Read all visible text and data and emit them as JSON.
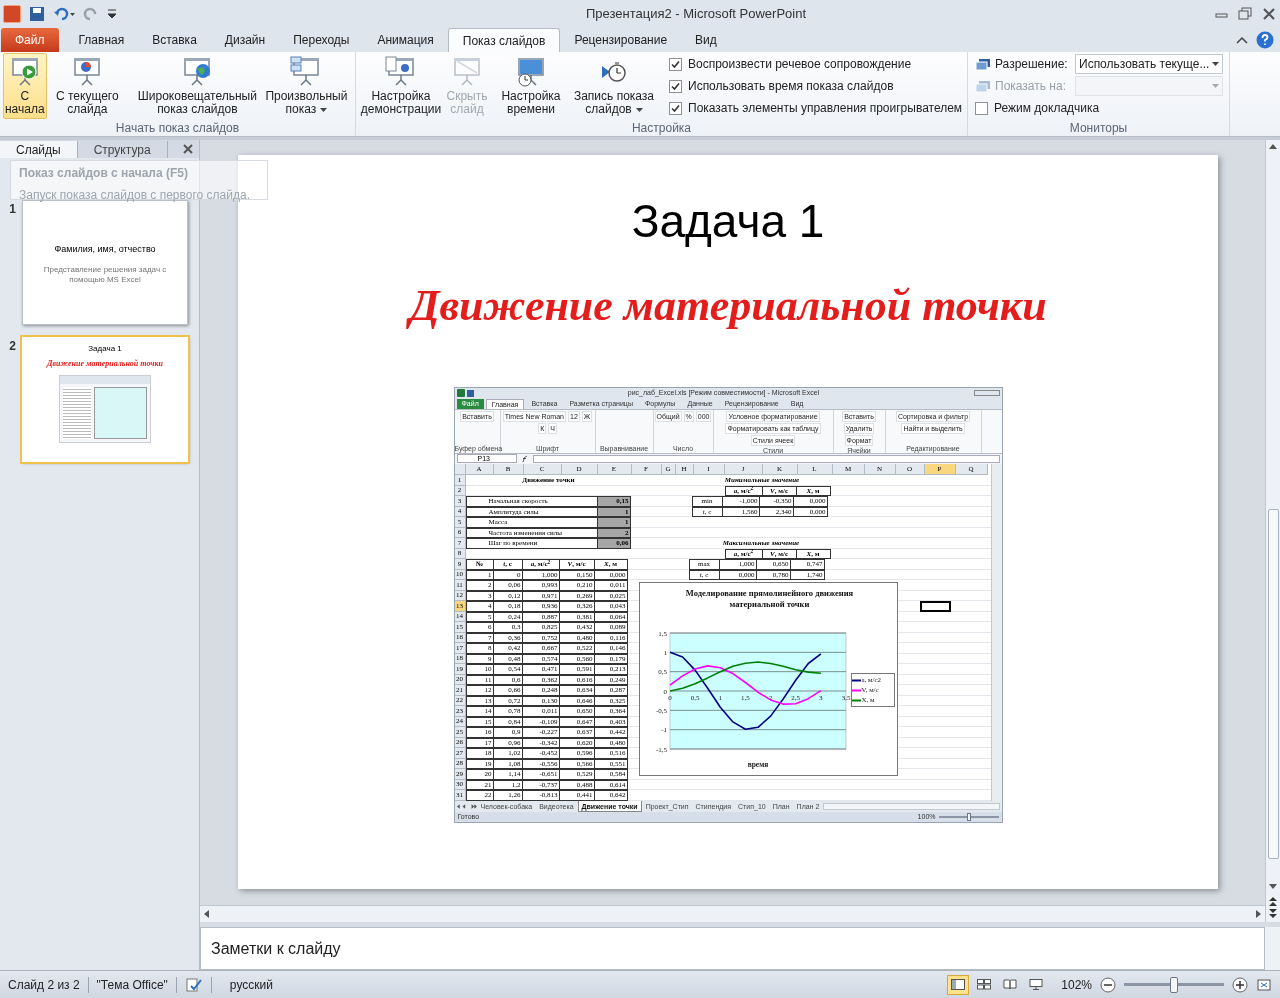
{
  "window": {
    "title": "Презентация2  -  Microsoft PowerPoint"
  },
  "ribbon_tabs": [
    {
      "label": "Файл",
      "kind": "file",
      "selected": false
    },
    {
      "label": "Главная",
      "kind": "tab",
      "selected": false
    },
    {
      "label": "Вставка",
      "kind": "tab",
      "selected": false
    },
    {
      "label": "Дизайн",
      "kind": "tab",
      "selected": false
    },
    {
      "label": "Переходы",
      "kind": "tab",
      "selected": false
    },
    {
      "label": "Анимация",
      "kind": "tab",
      "selected": false
    },
    {
      "label": "Показ слайдов",
      "kind": "tab",
      "selected": true
    },
    {
      "label": "Рецензирование",
      "kind": "tab",
      "selected": false
    },
    {
      "label": "Вид",
      "kind": "tab",
      "selected": false
    }
  ],
  "ribbon_groups": [
    {
      "label": "Начать показ слайдов",
      "buttons": [
        {
          "label": "С начала",
          "kind": "play",
          "hover": true,
          "disabled": false,
          "dropdown": false
        },
        {
          "label": "С текущего слайда",
          "kind": "current",
          "hover": false,
          "disabled": false,
          "dropdown": false
        },
        {
          "label": "Широковещательный показ слайдов",
          "kind": "broadcast",
          "hover": false,
          "disabled": false,
          "dropdown": false
        },
        {
          "label": "Произвольный показ",
          "kind": "custom",
          "hover": false,
          "disabled": false,
          "dropdown": true
        }
      ]
    },
    {
      "label": "Настройка",
      "buttons": [
        {
          "label": "Настройка демонстрации",
          "kind": "setup",
          "hover": false,
          "disabled": false,
          "dropdown": false
        },
        {
          "label": "Скрыть слайд",
          "kind": "hide",
          "hover": false,
          "disabled": true,
          "dropdown": false
        },
        {
          "label": "Настройка времени",
          "kind": "timing",
          "hover": false,
          "disabled": false,
          "dropdown": false
        },
        {
          "label": "Запись показа слайдов",
          "kind": "record",
          "hover": false,
          "disabled": false,
          "dropdown": true
        }
      ],
      "checkboxes": [
        {
          "label": "Воспроизвести речевое сопровождение",
          "checked": true
        },
        {
          "label": "Использовать время показа слайдов",
          "checked": true
        },
        {
          "label": "Показать элементы управления проигрывателем",
          "checked": true
        }
      ]
    },
    {
      "label": "Мониторы",
      "fields": [
        {
          "label": "Разрешение:",
          "value": "Использовать текуще...",
          "disabled": false
        },
        {
          "label": "Показать на:",
          "disabled": true
        }
      ],
      "checkboxes": [
        {
          "label": "Режим докладчика",
          "checked": false
        }
      ]
    }
  ],
  "tooltip": {
    "title": "Показ слайдов с начала (F5)",
    "text": "Запуск показа слайдов с первого слайда."
  },
  "pane": {
    "tabs": [
      {
        "label": "Слайды",
        "selected": true
      },
      {
        "label": "Структура",
        "selected": false
      }
    ],
    "thumbnails": [
      {
        "number": "1",
        "kind": "title-slide",
        "selected": false,
        "title": "Фамилия, имя, отчество",
        "subtitle": "Представление решения задач с помощью MS Excel"
      },
      {
        "number": "2",
        "kind": "content-slide",
        "selected": true,
        "title": "Задача 1",
        "subtitle": "Движение материальной точки"
      }
    ]
  },
  "slide": {
    "title": "Задача 1",
    "subtitle": "Движение материальной точки",
    "excel": {
      "title": "рис_лаб_Excel.xls  [Режим совместимости]  -  Microsoft Excel",
      "tabs": [
        {
          "label": "Файл",
          "kind": "file",
          "selected": false
        },
        {
          "label": "Главная",
          "kind": "tab",
          "selected": true
        },
        {
          "label": "Вставка",
          "kind": "tab",
          "selected": false
        },
        {
          "label": "Разметка страницы",
          "kind": "tab",
          "selected": false
        },
        {
          "label": "Формулы",
          "kind": "tab",
          "selected": false
        },
        {
          "label": "Данные",
          "kind": "tab",
          "selected": false
        },
        {
          "label": "Рецензирование",
          "kind": "tab",
          "selected": false
        },
        {
          "label": "Вид",
          "kind": "tab",
          "selected": false
        }
      ],
      "ribbon_groups": [
        {
          "label": "Буфер обмена",
          "items": [
            "Вставить"
          ]
        },
        {
          "label": "Шрифт",
          "items": [
            "Times New Roman",
            "12",
            "Ж",
            "К",
            "Ч"
          ]
        },
        {
          "label": "Выравнивание"
        },
        {
          "label": "Число",
          "items": [
            "Общий",
            "%",
            "000"
          ]
        },
        {
          "label": "Стили",
          "items": [
            "Условное форматирование",
            "Форматировать как таблицу",
            "Стили ячеек"
          ]
        },
        {
          "label": "Ячейки",
          "items": [
            "Вставить",
            "Удалить",
            "Формат"
          ]
        },
        {
          "label": "Редактирование",
          "items": [
            "Сортировка и фильтр",
            "Найти и выделить"
          ]
        }
      ],
      "name_box": "P13",
      "columns": [
        {
          "label": "A",
          "selected": false
        },
        {
          "label": "B",
          "selected": false
        },
        {
          "label": "C",
          "selected": false
        },
        {
          "label": "D",
          "selected": false
        },
        {
          "label": "E",
          "selected": false
        },
        {
          "label": "F",
          "selected": false
        },
        {
          "label": "G",
          "selected": false
        },
        {
          "label": "H",
          "selected": false
        },
        {
          "label": "I",
          "selected": false
        },
        {
          "label": "J",
          "selected": false
        },
        {
          "label": "K",
          "selected": false
        },
        {
          "label": "L",
          "selected": false
        },
        {
          "label": "M",
          "selected": false
        },
        {
          "label": "N",
          "selected": false
        },
        {
          "label": "O",
          "selected": false
        },
        {
          "label": "P",
          "selected": true
        },
        {
          "label": "Q",
          "selected": false
        }
      ],
      "row_headers": [
        {
          "label": "1",
          "selected": false
        },
        {
          "label": "2",
          "selected": false
        },
        {
          "label": "3",
          "selected": false
        },
        {
          "label": "4",
          "selected": false
        },
        {
          "label": "5",
          "selected": false
        },
        {
          "label": "6",
          "selected": false
        },
        {
          "label": "7",
          "selected": false
        },
        {
          "label": "8",
          "selected": false
        },
        {
          "label": "9",
          "selected": false
        },
        {
          "label": "10",
          "selected": false
        },
        {
          "label": "11",
          "selected": false
        },
        {
          "label": "12",
          "selected": false
        },
        {
          "label": "13",
          "selected": true
        },
        {
          "label": "14",
          "selected": false
        },
        {
          "label": "15",
          "selected": false
        },
        {
          "label": "16",
          "selected": false
        },
        {
          "label": "17",
          "selected": false
        },
        {
          "label": "18",
          "selected": false
        },
        {
          "label": "19",
          "selected": false
        },
        {
          "label": "20",
          "selected": false
        },
        {
          "label": "21",
          "selected": false
        },
        {
          "label": "22",
          "selected": false
        },
        {
          "label": "23",
          "selected": false
        },
        {
          "label": "24",
          "selected": false
        },
        {
          "label": "25",
          "selected": false
        },
        {
          "label": "26",
          "selected": false
        },
        {
          "label": "27",
          "selected": false
        },
        {
          "label": "28",
          "selected": false
        },
        {
          "label": "29",
          "selected": false
        },
        {
          "label": "30",
          "selected": false
        },
        {
          "label": "31",
          "selected": false
        }
      ],
      "sheet_title": "Движение точки",
      "params": [
        {
          "label": "Начальная скорость",
          "value": "0,15"
        },
        {
          "label": "Амплитуда силы",
          "value": "1"
        },
        {
          "label": "Масса",
          "value": "1"
        },
        {
          "label": "Частота изменения силы",
          "value": "2"
        },
        {
          "label": "Шаг по времени",
          "value": "0,06"
        }
      ],
      "min_table": {
        "caption": "Минимальные  значение",
        "columns": [
          "*a*, м/с$^{2}$",
          "*V*, м/с",
          "*X*, м"
        ],
        "rows": [
          {
            "label": "min",
            "values": [
              "-1,000",
              "-0,350",
              "0,000"
            ]
          },
          {
            "label": "*t*, с",
            "values": [
              "1,560",
              "2,340",
              "0,000"
            ]
          }
        ]
      },
      "max_table": {
        "caption": "Максимальные  значение",
        "columns": [
          "*a*, м/с$^{2}$",
          "*V*, м/с",
          "*X*, м"
        ],
        "rows": [
          {
            "label": "max",
            "values": [
              "1,000",
              "0,650",
              "0,747"
            ]
          },
          {
            "label": "*t*, с",
            "values": [
              "0,000",
              "0,780",
              "1,740"
            ]
          }
        ]
      },
      "data_table": {
        "columns": [
          "№",
          "*t*, с",
          "*a*, м/с$^{2}$",
          "*V*, м/с",
          "*X*, м"
        ],
        "rows": [
          [
            "1",
            "0",
            "1,000",
            "0,150",
            "0,000"
          ],
          [
            "2",
            "0,06",
            "0,993",
            "0,210",
            "0,011"
          ],
          [
            "3",
            "0,12",
            "0,971",
            "0,269",
            "0,025"
          ],
          [
            "4",
            "0,18",
            "0,936",
            "0,326",
            "0,043"
          ],
          [
            "5",
            "0,24",
            "0,887",
            "0,381",
            "0,064"
          ],
          [
            "6",
            "0,3",
            "0,825",
            "0,432",
            "0,089"
          ],
          [
            "7",
            "0,36",
            "0,752",
            "0,480",
            "0,116"
          ],
          [
            "8",
            "0,42",
            "0,667",
            "0,522",
            "0,146"
          ],
          [
            "9",
            "0,48",
            "0,574",
            "0,560",
            "0,179"
          ],
          [
            "10",
            "0,54",
            "0,471",
            "0,591",
            "0,213"
          ],
          [
            "11",
            "0,6",
            "0,362",
            "0,616",
            "0,249"
          ],
          [
            "12",
            "0,66",
            "0,248",
            "0,634",
            "0,287"
          ],
          [
            "13",
            "0,72",
            "0,130",
            "0,646",
            "0,325"
          ],
          [
            "14",
            "0,78",
            "0,011",
            "0,650",
            "0,364"
          ],
          [
            "15",
            "0,84",
            "-0,109",
            "0,647",
            "0,403"
          ],
          [
            "16",
            "0,9",
            "-0,227",
            "0,637",
            "0,442"
          ],
          [
            "17",
            "0,96",
            "-0,342",
            "0,620",
            "0,480"
          ],
          [
            "18",
            "1,02",
            "-0,452",
            "0,596",
            "0,516"
          ],
          [
            "19",
            "1,08",
            "-0,556",
            "0,566",
            "0,551"
          ],
          [
            "20",
            "1,14",
            "-0,651",
            "0,529",
            "0,584"
          ],
          [
            "21",
            "1,2",
            "-0,737",
            "0,488",
            "0,614"
          ],
          [
            "22",
            "1,26",
            "-0,813",
            "0,441",
            "0,642"
          ]
        ]
      },
      "chart": {
        "chart_data": {
          "type": "line",
          "title": "Моделирование прямолинейного движения материальной точки",
          "xlabel": "время",
          "x": [
            0,
            0.25,
            0.5,
            0.75,
            1,
            1.25,
            1.5,
            1.75,
            2,
            2.25,
            2.5,
            2.75,
            3
          ],
          "series": [
            {
              "name": "a, м/с2",
              "color": "#000080",
              "values": [
                1,
                0.88,
                0.54,
                0.07,
                -0.42,
                -0.8,
                -0.99,
                -0.94,
                -0.65,
                -0.21,
                0.28,
                0.71,
                0.96
              ]
            },
            {
              "name": "V, м/с",
              "color": "#ff00ff",
              "values": [
                0.15,
                0.39,
                0.57,
                0.65,
                0.6,
                0.45,
                0.22,
                -0.03,
                -0.23,
                -0.34,
                -0.33,
                -0.2,
                0.01
              ]
            },
            {
              "name": "X, м",
              "color": "#008000",
              "values": [
                0,
                0.07,
                0.19,
                0.34,
                0.5,
                0.64,
                0.72,
                0.75,
                0.71,
                0.64,
                0.55,
                0.49,
                0.46
              ]
            }
          ],
          "xlim": [
            0,
            3.5
          ],
          "ylim": [
            -1.5,
            1.5
          ],
          "grid": true,
          "legend": "right",
          "xticks": [
            {
              "value": 0,
              "label": "0"
            },
            {
              "value": 0.5,
              "label": "0,5"
            },
            {
              "value": 1,
              "label": "1"
            },
            {
              "value": 1.5,
              "label": "1,5"
            },
            {
              "value": 2,
              "label": "2"
            },
            {
              "value": 2.5,
              "label": "2,5"
            },
            {
              "value": 3,
              "label": "3"
            },
            {
              "value": 3.5,
              "label": "3,5"
            }
          ],
          "yticks": [
            {
              "value": -1.5,
              "label": "-1,5"
            },
            {
              "value": -1,
              "label": "-1"
            },
            {
              "value": -0.5,
              "label": "-0,5"
            },
            {
              "value": 0,
              "label": "0"
            },
            {
              "value": 0.5,
              "label": "0,5"
            },
            {
              "value": 1,
              "label": "1"
            },
            {
              "value": 1.5,
              "label": "1,5"
            }
          ]
        }
      },
      "sheet_tabs": [
        {
          "label": "Человек-собака",
          "selected": false
        },
        {
          "label": "Видеотека",
          "selected": false
        },
        {
          "label": "Движение точки",
          "selected": true
        },
        {
          "label": "Проект_Стип",
          "selected": false
        },
        {
          "label": "Стипендия",
          "selected": false
        },
        {
          "label": "Стип_10",
          "selected": false
        },
        {
          "label": "План",
          "selected": false
        },
        {
          "label": "План 2",
          "selected": false
        }
      ],
      "status": "Готово",
      "zoom": "100%",
      "zoom_slider": {
        "level": 0.5
      }
    }
  },
  "notes": {
    "placeholder": "Заметки к слайду"
  },
  "status_bar": {
    "slide": "Слайд 2 из 2",
    "theme": "\"Тема Office\"",
    "language": "русский",
    "zoom": "102%",
    "views": [
      {
        "kind": "normal",
        "selected": true
      },
      {
        "kind": "sorter",
        "selected": false
      },
      {
        "kind": "reading",
        "selected": false
      },
      {
        "kind": "show",
        "selected": false
      }
    ],
    "zoom_slider": {
      "level": 0.5
    }
  }
}
